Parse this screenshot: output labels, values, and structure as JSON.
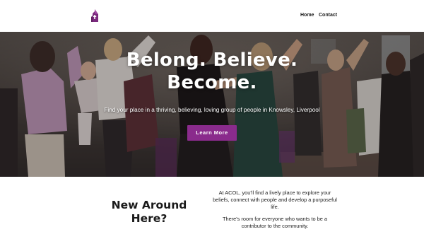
{
  "header": {
    "logo": "church-logo-icon",
    "nav": [
      {
        "label": "Home"
      },
      {
        "label": "Contact"
      }
    ]
  },
  "hero": {
    "title_line1": "Belong. Believe.",
    "title_line2": "Become.",
    "subtitle": "Find your place in a thriving, believing, loving group of people in Knowsley, Liverpool",
    "button_label": "Learn More",
    "button_color": "#8a2b8c"
  },
  "intro": {
    "heading": "New Around Here?",
    "paragraph1": "At ACOL, you'll find a lively place to explore your beliefs, connect with people and develop a purposeful life.",
    "paragraph2": "There's room for everyone who wants to be a contributor to the community."
  },
  "colors": {
    "accent": "#8a2b8c",
    "text": "#1a1a1a"
  }
}
